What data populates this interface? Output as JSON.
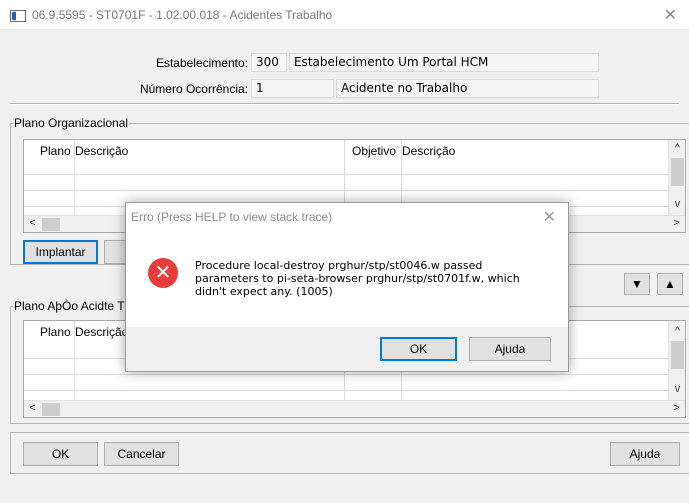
{
  "window": {
    "title": "06.9.5595 - ST0701F - 1.02.00.018 - Acidentes Trabalho",
    "close_glyph": "✕"
  },
  "header": {
    "estabelecimento_label": "Estabelecimento:",
    "estabelecimento_code": "300",
    "estabelecimento_name": "Estabelecimento Um Portal HCM",
    "ocorrencia_label": "Número Ocorrência:",
    "ocorrencia_number": "1",
    "ocorrencia_desc": "Acidente no Trabalho"
  },
  "plano_org": {
    "label": "Plano Organizacional",
    "columns": [
      "Plano",
      "Descrição",
      "Objetivo",
      "Descrição"
    ],
    "implantar_button": "Implantar"
  },
  "plano_acao": {
    "label": "Plano AþÒo Acidte T",
    "columns": [
      "Plano",
      "Descrição"
    ]
  },
  "footer": {
    "ok_button": "OK",
    "cancel_button": "Cancelar",
    "help_button": "Ajuda"
  },
  "dialog": {
    "title": "Erro (Press HELP to view stack trace)",
    "close_glyph": "✕",
    "error_glyph": "✕",
    "message_line1": "Procedure local-destroy prghur/stp/st0046.w passed",
    "message_line2": "parameters to pi-seta-browser prghur/stp/st0701f.w, which",
    "message_line3": "didn't expect any. (1005)",
    "ok_button": "OK",
    "help_button": "Ajuda"
  },
  "icons": {
    "arrow_up": "▲",
    "arrow_down": "▼",
    "arrow_left": "<",
    "arrow_right": ">",
    "chevron_up": "^",
    "chevron_down": "v"
  }
}
